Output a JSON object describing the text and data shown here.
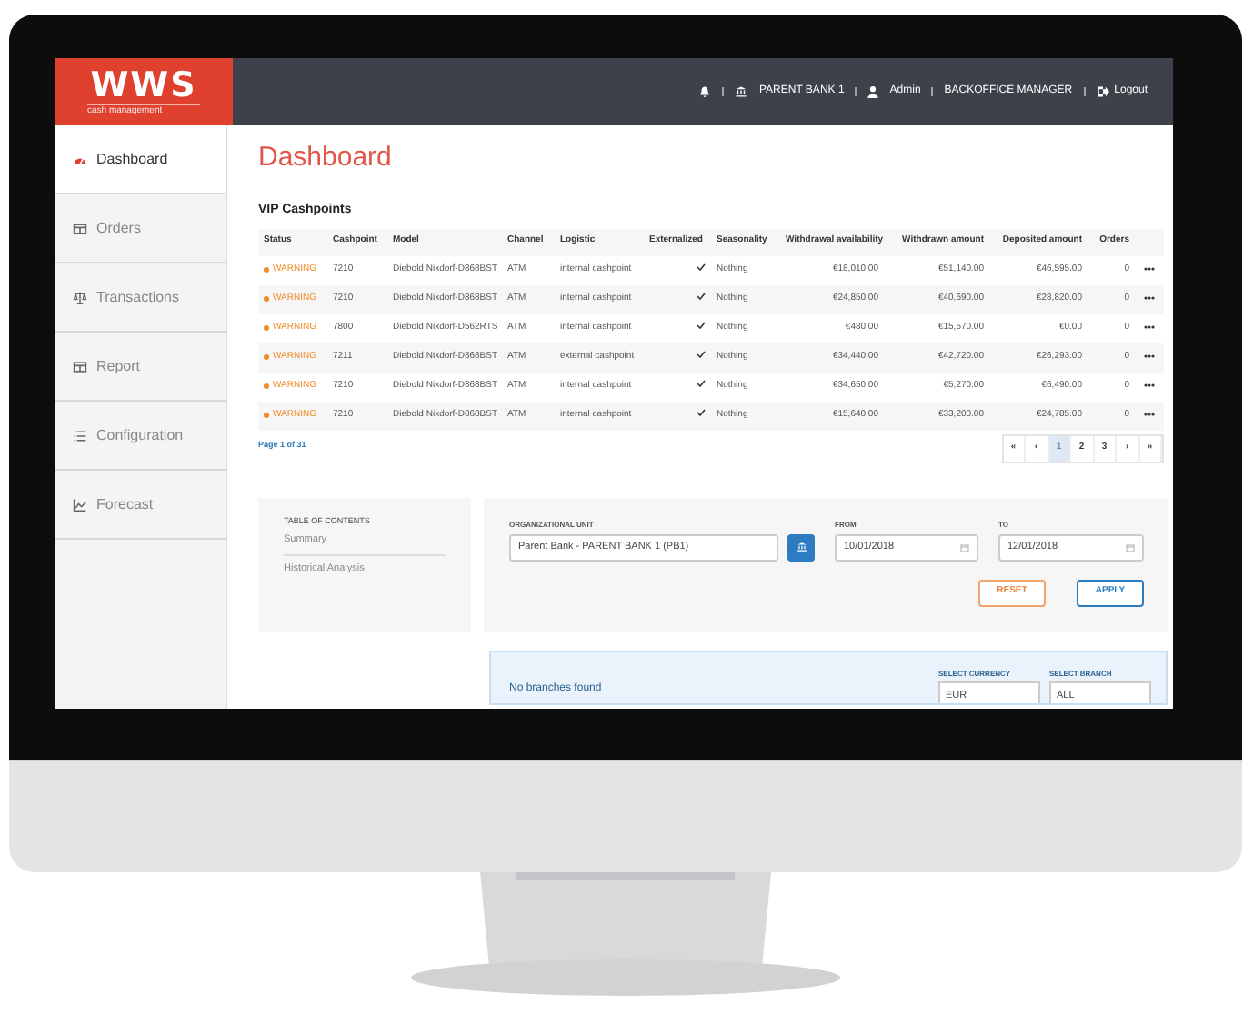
{
  "logo": {
    "text": "WWS",
    "subtitle": "cash management"
  },
  "header": {
    "bank": "PARENT BANK 1",
    "user": "Admin",
    "role": "BACKOFFICE MANAGER",
    "logout": "Logout"
  },
  "sidebar": [
    {
      "label": "Dashboard",
      "selected": true
    },
    {
      "label": "Orders",
      "selected": false
    },
    {
      "label": "Transactions",
      "selected": false
    },
    {
      "label": "Report",
      "selected": false
    },
    {
      "label": "Configuration",
      "selected": false
    },
    {
      "label": "Forecast",
      "selected": false
    }
  ],
  "page_title": "Dashboard",
  "vip_cashpoints": {
    "title": "VIP Cashpoints",
    "columns": [
      "Status",
      "Cashpoint",
      "Model",
      "Channel",
      "Logistic",
      "Externalized",
      "Seasonality",
      "Withdrawal availability",
      "Withdrawn amount",
      "Deposited amount",
      "Orders"
    ],
    "rows": [
      {
        "status": "WARNING",
        "cashpoint": "7210",
        "model": "Diebold Nixdorf-D868BST",
        "channel": "ATM",
        "logistic": "internal cashpoint",
        "externalized": true,
        "seasonality": "Nothing",
        "withdrawal_availability": "€18,010.00",
        "withdrawn_amount": "€51,140.00",
        "deposited_amount": "€46,595.00",
        "orders": "0"
      },
      {
        "status": "WARNING",
        "cashpoint": "7210",
        "model": "Diebold Nixdorf-D868BST",
        "channel": "ATM",
        "logistic": "internal cashpoint",
        "externalized": true,
        "seasonality": "Nothing",
        "withdrawal_availability": "€24,850.00",
        "withdrawn_amount": "€40,690.00",
        "deposited_amount": "€28,820.00",
        "orders": "0"
      },
      {
        "status": "WARNING",
        "cashpoint": "7800",
        "model": "Diebold Nixdorf-D562RTS",
        "channel": "ATM",
        "logistic": "internal cashpoint",
        "externalized": true,
        "seasonality": "Nothing",
        "withdrawal_availability": "€480.00",
        "withdrawn_amount": "€15,570.00",
        "deposited_amount": "€0.00",
        "orders": "0"
      },
      {
        "status": "WARNING",
        "cashpoint": "7211",
        "model": "Diebold Nixdorf-D868BST",
        "channel": "ATM",
        "logistic": "external cashpoint",
        "externalized": true,
        "seasonality": "Nothing",
        "withdrawal_availability": "€34,440.00",
        "withdrawn_amount": "€42,720.00",
        "deposited_amount": "€26,293.00",
        "orders": "0"
      },
      {
        "status": "WARNING",
        "cashpoint": "7210",
        "model": "Diebold Nixdorf-D868BST",
        "channel": "ATM",
        "logistic": "internal cashpoint",
        "externalized": true,
        "seasonality": "Nothing",
        "withdrawal_availability": "€34,650.00",
        "withdrawn_amount": "€5,270.00",
        "deposited_amount": "€6,490.00",
        "orders": "0"
      },
      {
        "status": "WARNING",
        "cashpoint": "7210",
        "model": "Diebold Nixdorf-D868BST",
        "channel": "ATM",
        "logistic": "internal cashpoint",
        "externalized": true,
        "seasonality": "Nothing",
        "withdrawal_availability": "€15,640.00",
        "withdrawn_amount": "€33,200.00",
        "deposited_amount": "€24,785.00",
        "orders": "0"
      }
    ],
    "page_info": "Page 1 of 31",
    "pagination": [
      {
        "label": "«",
        "selected": false
      },
      {
        "label": "‹",
        "selected": false
      },
      {
        "label": "1",
        "selected": true
      },
      {
        "label": "2",
        "selected": false
      },
      {
        "label": "3",
        "selected": false
      },
      {
        "label": "›",
        "selected": false
      },
      {
        "label": "»",
        "selected": false
      }
    ]
  },
  "table_of_contents": {
    "title": "TABLE OF CONTENTS",
    "items": [
      "Summary",
      "Historical Analysis"
    ]
  },
  "filters": {
    "org_unit": {
      "label": "ORGANIZATIONAL UNIT",
      "value": "Parent Bank - PARENT BANK 1 (PB1)"
    },
    "from": {
      "label": "FROM",
      "value": "10/01/2018"
    },
    "to": {
      "label": "TO",
      "value": "12/01/2018"
    },
    "buttons": [
      "RESET",
      "APPLY"
    ]
  },
  "branches": {
    "message": "No branches found",
    "currency": {
      "label": "SELECT CURRENCY",
      "value": "EUR"
    },
    "branch": {
      "label": "SELECT BRANCH",
      "value": "ALL"
    }
  }
}
